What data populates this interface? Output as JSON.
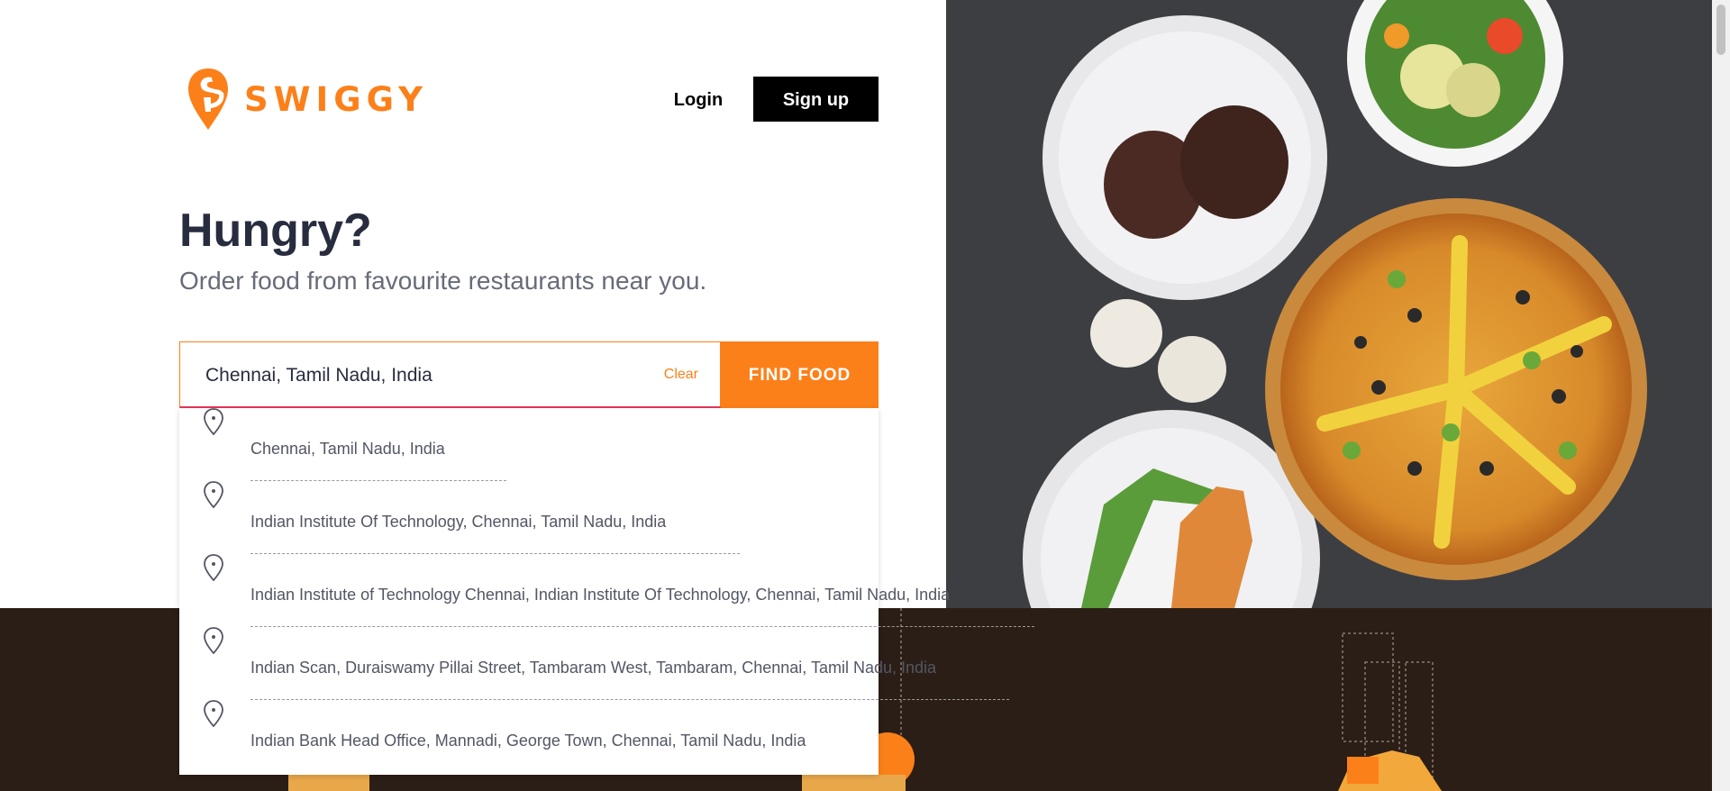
{
  "brand": {
    "name": "SWIGGY",
    "accent_color": "#fc8019",
    "logo_icon": "swiggy-pin-logo"
  },
  "header": {
    "login_label": "Login",
    "signup_label": "Sign up"
  },
  "hero": {
    "title": "Hungry?",
    "subtitle": "Order food from favourite restaurants near you."
  },
  "search": {
    "value": "Chennai, Tamil Nadu, India",
    "clear_label": "Clear",
    "button_label": "FIND FOOD"
  },
  "suggestions": [
    {
      "text": "Chennai, Tamil Nadu, India",
      "icon": "location-pin-icon"
    },
    {
      "text": "Indian Institute Of Technology, Chennai, Tamil Nadu, India",
      "icon": "location-pin-icon"
    },
    {
      "text": "Indian Institute of Technology Chennai, Indian Institute Of Technology, Chennai, Tamil Nadu, India",
      "icon": "location-pin-icon"
    },
    {
      "text": "Indian Scan, Duraiswamy Pillai Street, Tambaram West, Tambaram, Chennai, Tamil Nadu, India",
      "icon": "location-pin-icon"
    },
    {
      "text": "Indian Bank Head Office, Mannadi, George Town, Chennai, Tamil Nadu, India",
      "icon": "location-pin-icon"
    }
  ],
  "colors": {
    "footer_band": "#2b1e16",
    "photo_background": "#3c3d40",
    "headline_text": "#282c3f",
    "subtitle_text": "#686b78"
  }
}
